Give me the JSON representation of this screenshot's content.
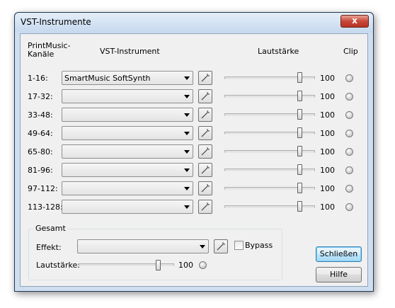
{
  "window": {
    "title": "VST-Instrumente",
    "close_label": "x"
  },
  "headers": {
    "channels": "PrintMusic-\nKanäle",
    "instrument": "VST-Instrument",
    "volume": "Lautstärke",
    "clip": "Clip"
  },
  "rows": [
    {
      "channels": "1-16:",
      "instrument": "SmartMusic SoftSynth",
      "volume": "100",
      "volume_level": 0.85
    },
    {
      "channels": "17-32:",
      "instrument": "",
      "volume": "100",
      "volume_level": 0.85
    },
    {
      "channels": "33-48:",
      "instrument": "",
      "volume": "100",
      "volume_level": 0.85
    },
    {
      "channels": "49-64:",
      "instrument": "",
      "volume": "100",
      "volume_level": 0.85
    },
    {
      "channels": "65-80:",
      "instrument": "",
      "volume": "100",
      "volume_level": 0.85
    },
    {
      "channels": "81-96:",
      "instrument": "",
      "volume": "100",
      "volume_level": 0.85
    },
    {
      "channels": "97-112:",
      "instrument": "",
      "volume": "100",
      "volume_level": 0.85
    },
    {
      "channels": "113-128:",
      "instrument": "",
      "volume": "100",
      "volume_level": 0.85
    }
  ],
  "master": {
    "group_label": "Gesamt",
    "effect_label": "Effekt:",
    "effect_value": "",
    "bypass_label": "Bypass",
    "bypass_checked": false,
    "volume_label": "Lautstärke:",
    "volume": "100",
    "volume_level": 0.85
  },
  "buttons": {
    "close": "Schließen",
    "help": "Hilfe"
  },
  "icons": {
    "edit": "wand-icon",
    "clip": "clip-led-icon"
  }
}
